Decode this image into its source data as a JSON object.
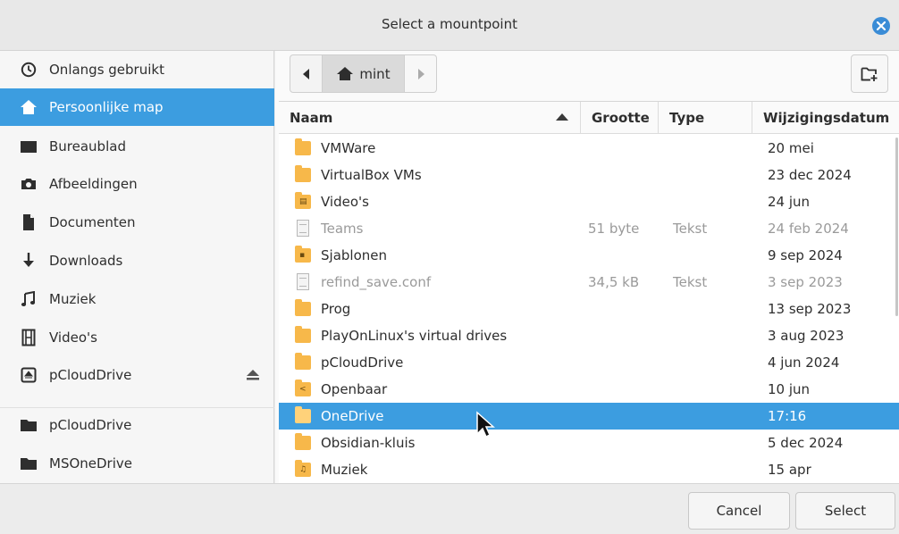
{
  "window": {
    "title": "Select a mountpoint"
  },
  "sidebar": {
    "items": [
      {
        "label": "Onlangs gebruikt",
        "icon": "clock-icon",
        "selected": false
      },
      {
        "label": "Persoonlijke map",
        "icon": "home-icon",
        "selected": true
      },
      {
        "label": "Bureaublad",
        "icon": "desktop-icon",
        "selected": false
      },
      {
        "label": "Afbeeldingen",
        "icon": "camera-icon",
        "selected": false
      },
      {
        "label": "Documenten",
        "icon": "document-icon",
        "selected": false
      },
      {
        "label": "Downloads",
        "icon": "download-arrow-icon",
        "selected": false
      },
      {
        "label": "Muziek",
        "icon": "music-note-icon",
        "selected": false
      },
      {
        "label": "Video's",
        "icon": "film-icon",
        "selected": false
      },
      {
        "label": "pCloudDrive",
        "icon": "drive-icon",
        "selected": false,
        "ejectable": true
      },
      {
        "label": "pCloudDrive",
        "icon": "folder-dark-icon",
        "selected": false
      },
      {
        "label": "MSOneDrive",
        "icon": "folder-dark-icon",
        "selected": false
      }
    ]
  },
  "pathbar": {
    "current": "mint"
  },
  "table": {
    "columns": {
      "name": "Naam",
      "size": "Grootte",
      "type": "Type",
      "date": "Wijzigingsdatum"
    },
    "sort": {
      "column": "name",
      "direction": "descending"
    },
    "rows": [
      {
        "name": "VMWare",
        "size": "",
        "type": "",
        "date": "20 mei",
        "kind": "folder"
      },
      {
        "name": "VirtualBox VMs",
        "size": "",
        "type": "",
        "date": "23 dec 2024",
        "kind": "folder"
      },
      {
        "name": "Video's",
        "size": "",
        "type": "",
        "date": "24 jun",
        "kind": "folder-videos"
      },
      {
        "name": "Teams",
        "size": "51 byte",
        "type": "Tekst",
        "date": "24 feb 2024",
        "kind": "text-file"
      },
      {
        "name": "Sjablonen",
        "size": "",
        "type": "",
        "date": "9 sep 2024",
        "kind": "folder-templates"
      },
      {
        "name": "refind_save.conf",
        "size": "34,5 kB",
        "type": "Tekst",
        "date": "3 sep 2023",
        "kind": "text-file"
      },
      {
        "name": "Prog",
        "size": "",
        "type": "",
        "date": "13 sep 2023",
        "kind": "folder"
      },
      {
        "name": "PlayOnLinux's virtual drives",
        "size": "",
        "type": "",
        "date": "3 aug 2023",
        "kind": "folder"
      },
      {
        "name": "pCloudDrive",
        "size": "",
        "type": "",
        "date": "4 jun 2024",
        "kind": "folder"
      },
      {
        "name": "Openbaar",
        "size": "",
        "type": "",
        "date": "10 jun",
        "kind": "folder-public"
      },
      {
        "name": "OneDrive",
        "size": "",
        "type": "",
        "date": "17:16",
        "kind": "folder",
        "selected": true
      },
      {
        "name": "Obsidian-kluis",
        "size": "",
        "type": "",
        "date": "5 dec 2024",
        "kind": "folder"
      },
      {
        "name": "Muziek",
        "size": "",
        "type": "",
        "date": "15 apr",
        "kind": "folder-music"
      }
    ]
  },
  "footer": {
    "cancel_label": "Cancel",
    "select_label": "Select"
  },
  "colors": {
    "accent": "#3c9de0",
    "folder": "#f7b84a",
    "close": "#3a8cd6"
  }
}
